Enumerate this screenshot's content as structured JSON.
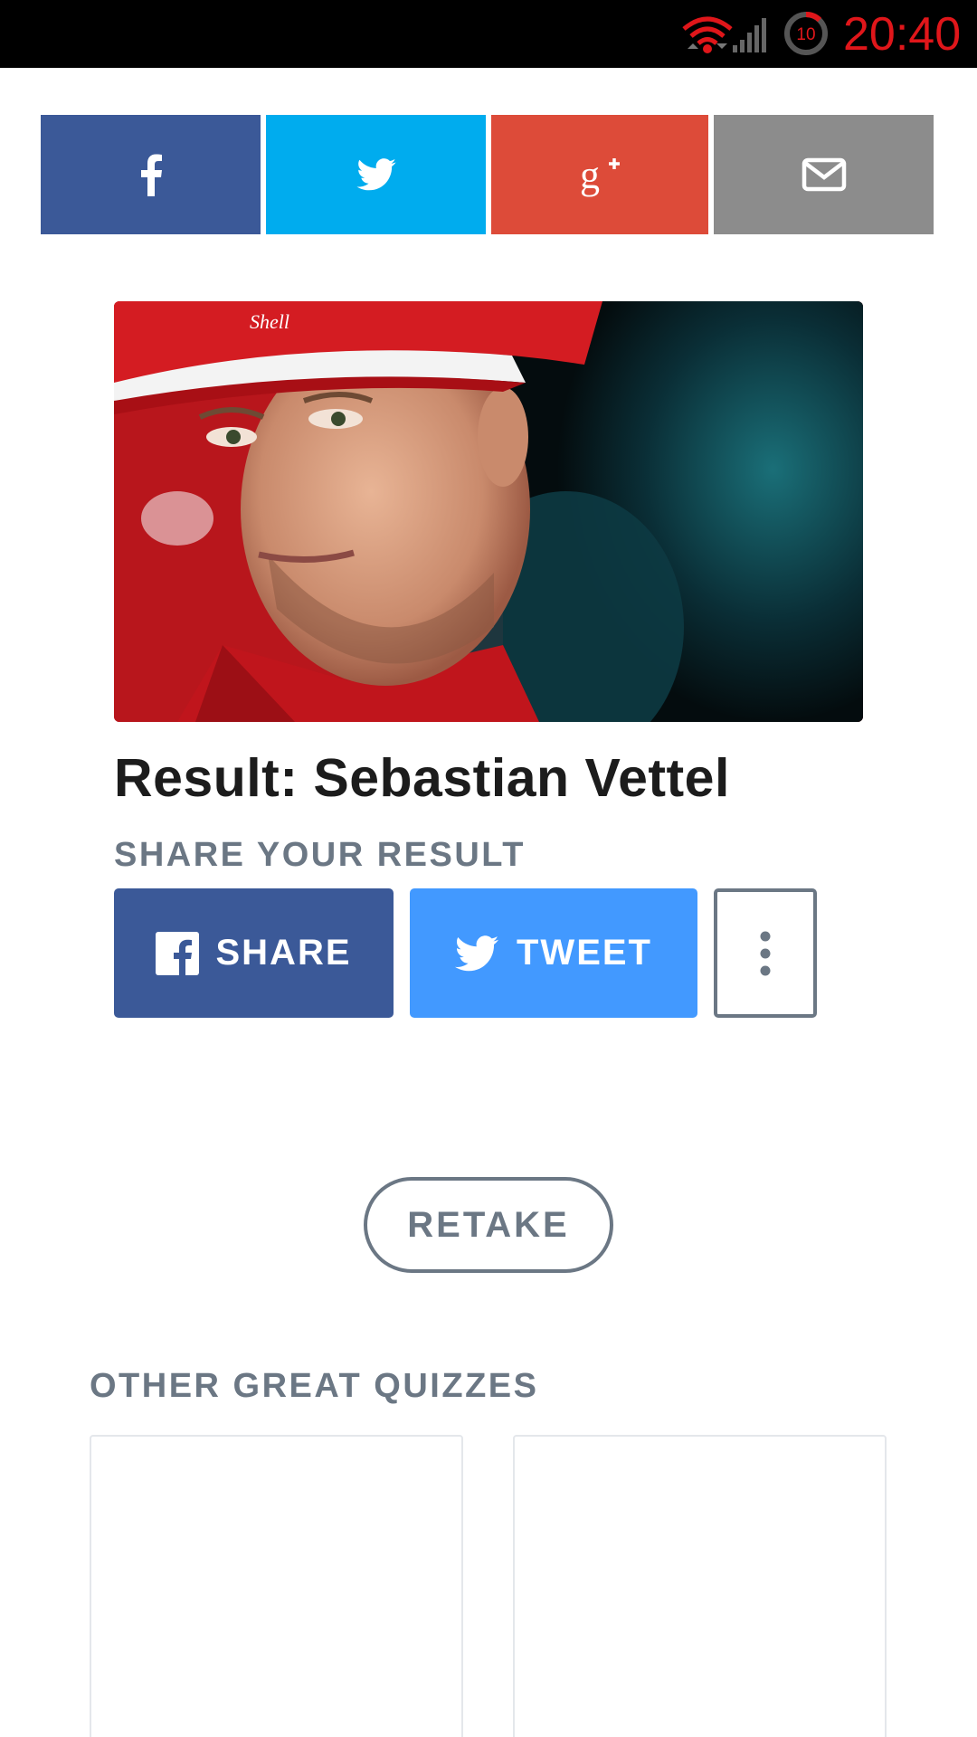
{
  "status_bar": {
    "time": "20:40",
    "timer_value": "10",
    "icons": [
      "wifi-icon",
      "signal-icon",
      "timer-icon"
    ],
    "accent_color": "#e0161a"
  },
  "share_bar": {
    "buttons": [
      {
        "name": "facebook",
        "icon": "facebook-icon",
        "color": "#3b5998"
      },
      {
        "name": "twitter",
        "icon": "twitter-icon",
        "color": "#00acee"
      },
      {
        "name": "google-plus",
        "icon": "google-plus-icon",
        "color": "#dd4b39"
      },
      {
        "name": "email",
        "icon": "mail-icon",
        "color": "#8c8c8c"
      }
    ]
  },
  "result": {
    "title": "Result: Sebastian Vettel",
    "share_label": "SHARE YOUR RESULT",
    "share_button": "SHARE",
    "tweet_button": "TWEET",
    "share_color": "#3b5998",
    "tweet_color": "#4299ff"
  },
  "retake_button": "RETAKE",
  "other_quizzes": {
    "heading": "OTHER GREAT QUIZZES"
  }
}
